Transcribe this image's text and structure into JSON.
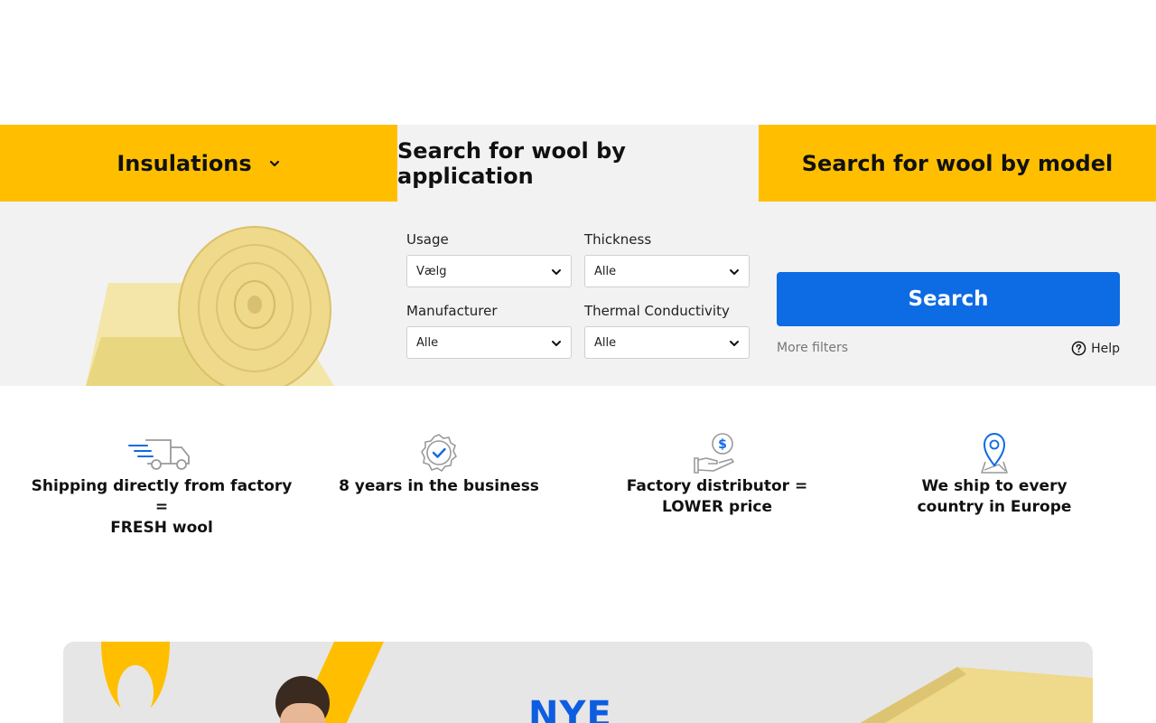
{
  "tabs": [
    {
      "label": "Insulations"
    },
    {
      "label": "Search for wool by application"
    },
    {
      "label": "Search for wool by model"
    }
  ],
  "filters": {
    "usage": {
      "label": "Usage",
      "value": "Vælg"
    },
    "thickness": {
      "label": "Thickness",
      "value": "Alle"
    },
    "manufacturer": {
      "label": "Manufacturer",
      "value": "Alle"
    },
    "thermal": {
      "label": "Thermal Conductivity",
      "value": "Alle"
    }
  },
  "search_label": "Search",
  "more_filters_label": "More filters",
  "help_label": "Help",
  "features": [
    {
      "icon": "truck-icon",
      "text": "Shipping directly from factory\n=\nFRESH wool"
    },
    {
      "icon": "badge-check-icon",
      "text": "8 years in the business"
    },
    {
      "icon": "hand-dollar-icon",
      "text": "Factory distributor =\nLOWER price"
    },
    {
      "icon": "map-pin-icon",
      "text": "We ship to every\ncountry in Europe"
    }
  ],
  "banner": {
    "text": "NYE"
  },
  "colors": {
    "accent_yellow": "#ffbf00",
    "primary_blue": "#0d6be3",
    "panel_gray": "#f2f2f2"
  }
}
